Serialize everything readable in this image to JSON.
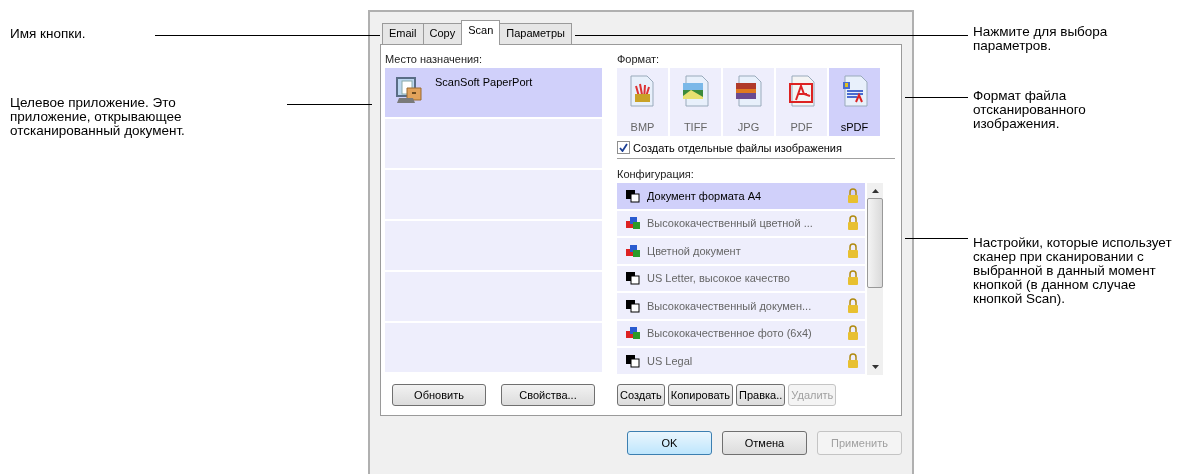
{
  "left_annotations": [
    {
      "text": "Имя кнопки."
    },
    {
      "text": "Целевое приложение. Это приложение, открывающее отсканированный документ."
    }
  ],
  "right_annotations": [
    {
      "text": "Нажмите для выбора параметров."
    },
    {
      "text": "Формат файла отсканированного изображения."
    },
    {
      "text": "Настройки, которые использует сканер при сканировании с выбранной в данный момент кнопкой (в данном случае кнопкой Scan)."
    }
  ],
  "dialog": {
    "tabs": [
      {
        "label": "Email",
        "selected": false
      },
      {
        "label": "Copy",
        "selected": false
      },
      {
        "label": "Scan",
        "selected": true
      },
      {
        "label": "Параметры",
        "selected": false
      }
    ],
    "destination": {
      "label": "Место назначения:",
      "items": [
        {
          "kind": "app",
          "name": "ScanSoft PaperPort",
          "selected": true
        },
        {
          "kind": "empty",
          "selected": false
        },
        {
          "kind": "empty",
          "selected": false
        },
        {
          "kind": "empty",
          "selected": false
        },
        {
          "kind": "empty",
          "selected": false
        },
        {
          "kind": "empty",
          "selected": false
        }
      ],
      "buttons": [
        {
          "label": "Обновить",
          "disabled": false
        },
        {
          "label": "Свойства...",
          "disabled": false
        }
      ]
    },
    "format": {
      "label": "Формат:",
      "items": [
        {
          "kind": "bmp",
          "label": "BMP",
          "selected": false
        },
        {
          "kind": "tiff",
          "label": "TIFF",
          "selected": false
        },
        {
          "kind": "jpg",
          "label": "JPG",
          "selected": false
        },
        {
          "kind": "pdf",
          "label": "PDF",
          "selected": false
        },
        {
          "kind": "spdf",
          "label": "sPDF",
          "selected": true
        }
      ],
      "checkbox": {
        "label": "Создать отдельные файлы изображения",
        "checked": true
      }
    },
    "configuration": {
      "label": "Конфигурация:",
      "items": [
        {
          "kind": "bw",
          "name": "Документ формата A4",
          "selected": true
        },
        {
          "kind": "color",
          "name": "Высококачественный цветной ...",
          "selected": false
        },
        {
          "kind": "color",
          "name": "Цветной документ",
          "selected": false
        },
        {
          "kind": "bw",
          "name": "US Letter, высокое качество",
          "selected": false
        },
        {
          "kind": "bw",
          "name": "Высококачественный докумен...",
          "selected": false
        },
        {
          "kind": "color",
          "name": "Высококачественное фото (6x4)",
          "selected": false
        },
        {
          "kind": "bw",
          "name": "US Legal",
          "selected": false
        }
      ],
      "buttons": [
        {
          "label": "Создать",
          "disabled": false
        },
        {
          "label": "Копировать",
          "disabled": false
        },
        {
          "label": "Правка..",
          "disabled": false
        },
        {
          "label": "Удалить",
          "disabled": true
        }
      ]
    },
    "footer_buttons": [
      {
        "label": "OK",
        "disabled": false,
        "default": true
      },
      {
        "label": "Отмена",
        "disabled": false,
        "default": false
      },
      {
        "label": "Применить",
        "disabled": true,
        "default": false
      }
    ]
  }
}
